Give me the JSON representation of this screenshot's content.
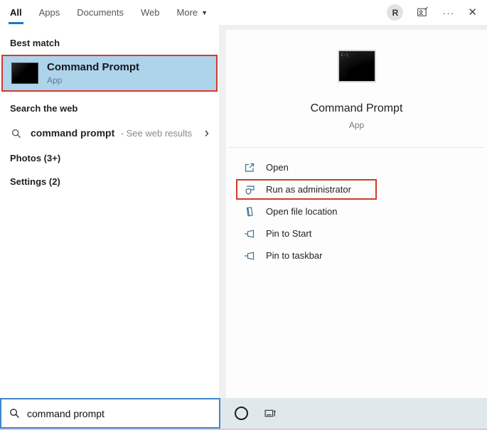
{
  "topbar": {
    "tabs": [
      {
        "label": "All",
        "active": true
      },
      {
        "label": "Apps",
        "active": false
      },
      {
        "label": "Documents",
        "active": false
      },
      {
        "label": "Web",
        "active": false
      },
      {
        "label": "More",
        "active": false
      }
    ],
    "more_caret": "▼",
    "avatar_initial": "R",
    "ellipsis": "···",
    "close_glyph": "✕"
  },
  "left_panel": {
    "best_match_header": "Best match",
    "best_match": {
      "title": "Command Prompt",
      "subtitle": "App"
    },
    "search_web_header": "Search the web",
    "web_search": {
      "query": "command prompt",
      "suffix": "- See web results",
      "chevron": "›"
    },
    "groups": [
      {
        "label": "Photos (3+)"
      },
      {
        "label": "Settings (2)"
      }
    ]
  },
  "right_panel": {
    "app_icon_text": "C:\\",
    "app_title": "Command Prompt",
    "app_subtitle": "App",
    "actions": [
      {
        "label": "Open"
      },
      {
        "label": "Run as administrator",
        "annotated": true
      },
      {
        "label": "Open file location"
      },
      {
        "label": "Pin to Start"
      },
      {
        "label": "Pin to taskbar"
      }
    ]
  },
  "taskbar": {
    "search_value": "command prompt"
  },
  "colors": {
    "best_match_highlight": "#aed4ec",
    "annotation_red": "#d23a2a",
    "accent_blue": "#0f7ad4",
    "taskbar_bg": "#dfe9ec",
    "search_border": "#3e87c8",
    "action_icon_blue": "#3f7088"
  }
}
